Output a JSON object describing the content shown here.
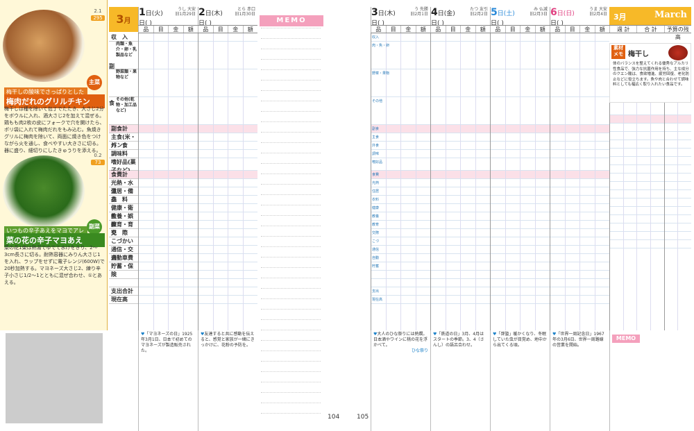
{
  "month": {
    "jp": "3",
    "unit": "月",
    "en": "March"
  },
  "recipes": [
    {
      "kcal_a": "2.1",
      "kcal_b": "295",
      "sub": "梅干しの酸味でさっぱりとした味わい",
      "title": "梅肉だれのグリルチキン",
      "badge": "主菜",
      "text": "梅干しは種を除いて包丁でたたき、大さじ2分をボウルに入れ、酒大さじ2を加えて混ぜる。鶏もも肉2枚の皮にフォークで穴を開けたら、ポリ袋に入れて梅肉だれをもみ込む。魚焼きグリルに梅肉を除いて、両面に焼き色をつけながら火を通し、食べやすい大きさに切る。器に盛り、細切りにしたきゅうりを添える。"
    },
    {
      "kcal_a": "0.2",
      "kcal_b": "73",
      "sub": "いつもの辛子あえをマヨでアレンジ",
      "title": "菜の花の辛子マヨあえ",
      "badge": "副菜",
      "text": "菜の花1束は熱湯でゆでて水けをきり、2～3cm長さに切る。耐熱容器にみりん大さじ1を入れ、ラップをせずに電子レンジ(600W)で20秒加熱する。マヨネーズ大さじ2、練り辛子小さじ1/2～1とともに混ぜ合わせ、①とあえる。"
    }
  ],
  "left_days": [
    {
      "num": "1",
      "dow": "日(火)",
      "sub": "日(  )",
      "rokuyo": "うし 大安",
      "lunar": "旧1月29日"
    },
    {
      "num": "2",
      "dow": "日(木)",
      "sub": "日(  )",
      "rokuyo": "とら 赤口",
      "lunar": "旧1月30日"
    }
  ],
  "right_days": [
    {
      "num": "3",
      "dow": "日(木)",
      "sub": "日(  )",
      "rokuyo": "う 先勝",
      "lunar": "旧2月1日"
    },
    {
      "num": "4",
      "dow": "日(金)",
      "sub": "日(  )",
      "rokuyo": "たつ 友引",
      "lunar": "旧2月2日"
    },
    {
      "num": "5",
      "dow": "日(土)",
      "sub": "日(  )",
      "rokuyo": "み 仏滅",
      "lunar": "旧2月3日"
    },
    {
      "num": "6",
      "dow": "日(日)",
      "sub": "日(  )",
      "rokuyo": "うま 大安",
      "lunar": "旧2月4日"
    }
  ],
  "col_headers": [
    "品",
    "目",
    "金",
    "額"
  ],
  "unit_labels": "千 百 十",
  "summary_headers": [
    "週 計",
    "合 計",
    "予算の残高"
  ],
  "categories": [
    {
      "label": "収　入",
      "pink": false
    },
    {
      "label": "肉類・魚介・卵・乳製品など",
      "pink": false
    },
    {
      "label": "野菜類・果物など",
      "pink": false
    },
    {
      "label": "その他(乾物・加工品など)",
      "pink": false
    },
    {
      "label": "副食計",
      "pink": true
    },
    {
      "label": "主食(米・パン)",
      "pink": false
    },
    {
      "label": "外　食",
      "pink": false
    },
    {
      "label": "調味料",
      "pink": false
    },
    {
      "label": "嗜好品(菓子など)",
      "pink": false
    },
    {
      "label": "食費計",
      "pink": true
    },
    {
      "label": "光熱・水道",
      "pink": false
    },
    {
      "label": "住居・備品",
      "pink": false
    },
    {
      "label": "衣　料",
      "pink": false
    },
    {
      "label": "健康・衛生",
      "pink": false
    },
    {
      "label": "教養・娯楽",
      "pink": false
    },
    {
      "label": "教育・育児",
      "pink": false
    },
    {
      "label": "交　際",
      "pink": false
    },
    {
      "label": "こづかい",
      "pink": false
    },
    {
      "label": "通信・交通",
      "pink": false
    },
    {
      "label": "自動車費",
      "pink": false
    },
    {
      "label": "貯蓄・保険",
      "pink": false
    },
    {
      "label": "",
      "pink": false
    },
    {
      "label": "",
      "pink": false
    },
    {
      "label": "支出合計",
      "pink": false
    },
    {
      "label": "現在高",
      "pink": false
    }
  ],
  "group_label": {
    "a": "副",
    "b": "食"
  },
  "memo_label": "MEMO",
  "memo2_label": "MEMO",
  "pages": {
    "left": "104",
    "right": "105"
  },
  "notes_left": [
    "「マヨネーズの日」1925年3月1日、日本で初めてのマヨネーズが製造販売された。",
    "友達すると共に感動を伝えると、感覚と家族が一緒にきっかけに、花粉の予防を。"
  ],
  "notes_right": [
    "大人のひな祭りには熱燗。日本酒やワインに桃の花を浮かべて。",
    "「鉄道の日」3月、4月はスタートの季節。3、4（さんし）の語呂合わせ。",
    "「啓蟄」暖かくなり、冬眠していた虫が目覚め、地中から出てくる頃。",
    "「世界一周記念日」1967年の3月6日、世界一周路線の営業を開始。"
  ],
  "hina_label": "ひな祭り",
  "sozai": {
    "tag": "素材メモ",
    "title": "梅干し",
    "text": "体のバランスを整えてくれる優秀なアルカリ性食品で、強力な抗菌作用を持ち、主な成分のクエン酸は、食欲増進、疲労回復、老化防止などに役立ちます。魚や肉と合わせて調味料としても幅広く取り入れたい食品です。"
  },
  "right_cat_labels": [
    "収入",
    "肉・魚・卵",
    "野菜・果物",
    "その他",
    "副食",
    "主食",
    "外食",
    "調味",
    "嗜好品",
    "食費",
    "光熱",
    "住居",
    "衣料",
    "健康",
    "教養",
    "教育",
    "交際",
    "こづ",
    "通信",
    "自動",
    "貯蓄",
    "支出",
    "現在高"
  ],
  "colors": {
    "accent": "#f7b928",
    "pink": "#fbe0e8",
    "memo": "#f4a0bc",
    "saturday": "#2a8ad8",
    "sunday": "#e04080"
  }
}
